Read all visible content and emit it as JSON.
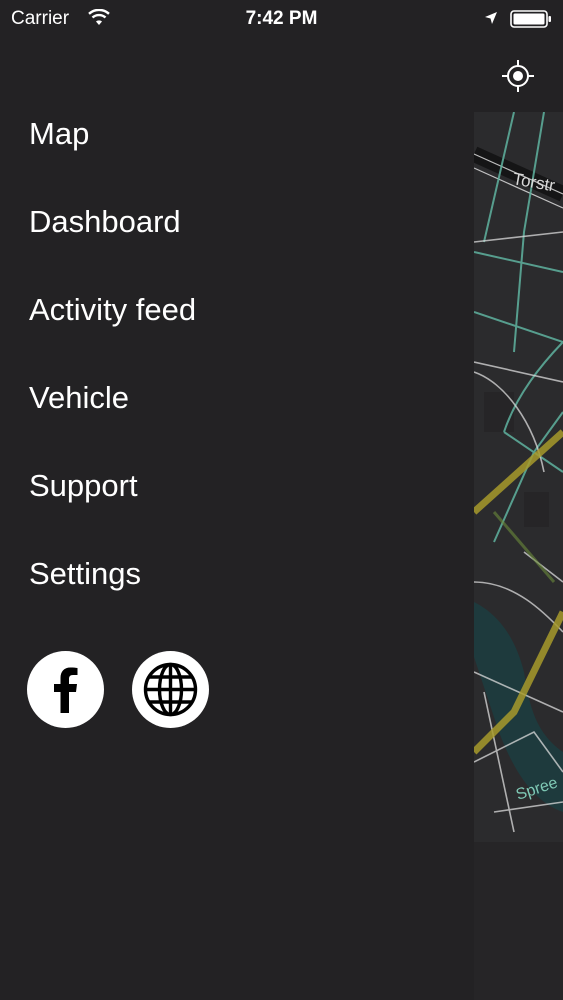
{
  "status_bar": {
    "carrier": "Carrier",
    "time": "7:42 PM",
    "icons": [
      "wifi-icon",
      "location-arrow-icon",
      "battery-icon"
    ]
  },
  "menu": {
    "items": [
      {
        "label": "Map"
      },
      {
        "label": "Dashboard"
      },
      {
        "label": "Activity feed"
      },
      {
        "label": "Vehicle"
      },
      {
        "label": "Support"
      },
      {
        "label": "Settings"
      }
    ]
  },
  "social": {
    "icons": [
      "facebook-icon",
      "globe-icon"
    ]
  },
  "map": {
    "street_labels": [
      "Torstr",
      "Spree"
    ],
    "locate_icon": "crosshair-icon"
  },
  "colors": {
    "background": "#232224",
    "map_background": "#2b2b2d",
    "road_highlight": "#5fb3a0",
    "major_road": "#a79a2c",
    "water": "#1e3a3d",
    "text": "#ffffff"
  }
}
